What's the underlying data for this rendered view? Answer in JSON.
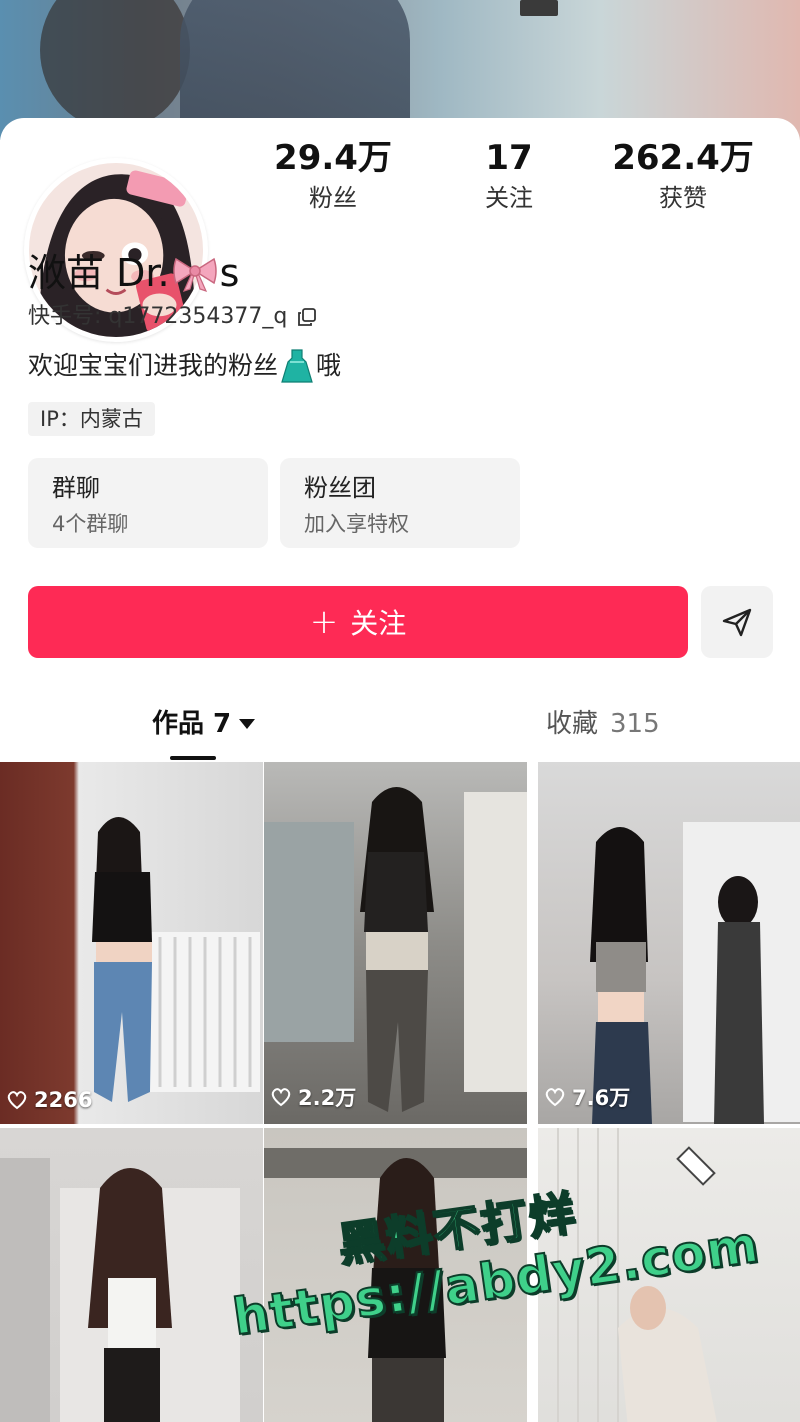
{
  "profile": {
    "name_prefix": "浟苗 Dr.",
    "name_suffix": "s",
    "account_id": "快手号: q1772354377_q",
    "bio_prefix": "欢迎宝宝们进我的粉丝",
    "bio_suffix": "哦",
    "ip": "IP：内蒙古"
  },
  "stats": [
    {
      "value": "29.4万",
      "label": "粉丝"
    },
    {
      "value": "17",
      "label": "关注"
    },
    {
      "value": "262.4万",
      "label": "获赞"
    }
  ],
  "cards": [
    {
      "title": "群聊",
      "subtitle": "4个群聊"
    },
    {
      "title": "粉丝团",
      "subtitle": "加入享特权"
    }
  ],
  "actions": {
    "follow_plus": "+",
    "follow_label": "关注"
  },
  "tabs": {
    "works_label": "作品 7",
    "favorites_label": "收藏",
    "favorites_count": "315"
  },
  "videos": [
    {
      "likes": "2266"
    },
    {
      "likes": "2.2万"
    },
    {
      "likes": "7.6万"
    },
    {
      "likes": ""
    },
    {
      "likes": ""
    },
    {
      "likes": ""
    }
  ],
  "watermark": {
    "line1": "黑料不打烊",
    "line2": "https://abdy2.com"
  },
  "colors": {
    "follow_button": "#fe2a55",
    "watermark": "#3fd08a"
  }
}
